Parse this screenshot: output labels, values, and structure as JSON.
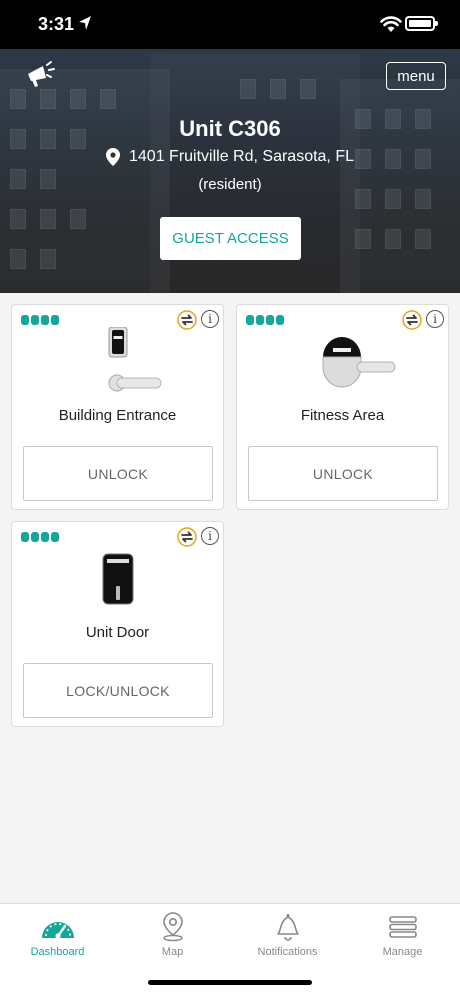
{
  "status_bar": {
    "time": "3:31"
  },
  "header": {
    "menu_label": "menu",
    "unit_title": "Unit C306",
    "address": "1401 Fruitville Rd, Sarasota, FL",
    "role": "(resident)",
    "guest_access_label": "GUEST ACCESS"
  },
  "locks": [
    {
      "title": "Building Entrance",
      "action_label": "UNLOCK"
    },
    {
      "title": "Fitness Area",
      "action_label": "UNLOCK"
    },
    {
      "title": "Unit Door",
      "action_label": "LOCK/UNLOCK"
    }
  ],
  "tabs": [
    {
      "label": "Dashboard",
      "icon": "dashboard-gauge-icon",
      "active": true
    },
    {
      "label": "Map",
      "icon": "map-pin-icon"
    },
    {
      "label": "Notifications",
      "icon": "bell-icon"
    },
    {
      "label": "Manage",
      "icon": "stacked-bars-icon"
    }
  ],
  "colors": {
    "accent": "#13a79a",
    "status_bar": "#000000",
    "card_border": "#dcdcdc"
  }
}
